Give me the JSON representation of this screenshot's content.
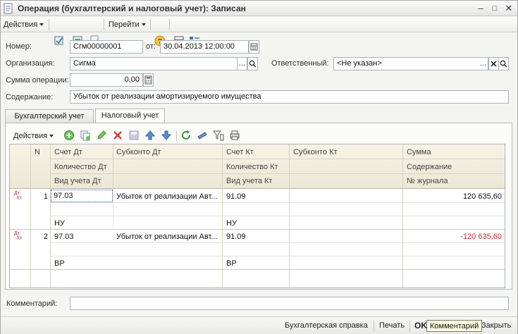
{
  "window": {
    "title": "Операция (бухгалтерский и налоговый учет): Записан",
    "controls": [
      "minimize-icon",
      "maximize-icon",
      "close-icon"
    ]
  },
  "toolbar": {
    "actions_label": "Действия",
    "goto_label": "Перейти"
  },
  "form": {
    "number_label": "Номер:",
    "number_value": "Сгм00000001",
    "date_label": "от:",
    "date_value": "30.04.2013 12:00:00",
    "org_label": "Организация:",
    "org_value": "Сигма",
    "org_btn": "...",
    "resp_label": "Ответственный:",
    "resp_value": "<Не указан>",
    "resp_btn": "...",
    "amount_label": "Сумма операции:",
    "amount_value": "0,00",
    "content_label": "Содержание:",
    "content_value": "Убыток от реализации амортизируемого имущества"
  },
  "tabs": [
    {
      "label": "Бухгалтерский учет",
      "active": false
    },
    {
      "label": "Налоговый учет",
      "active": true
    }
  ],
  "grid_toolbar": {
    "actions_label": "Действия"
  },
  "grid": {
    "headers": {
      "n": "N",
      "debit_account": "Счет Дт",
      "debit_subconto": "Субконто Дт",
      "credit_account": "Счет Кт",
      "credit_subconto": "Субконто Кт",
      "amount": "Сумма",
      "debit_qty": "Количество Дт",
      "credit_qty": "Количество Кт",
      "content": "Содержание",
      "debit_type": "Вид учета Дт",
      "credit_type": "Вид учета Кт",
      "journal_no": "№ журнала"
    },
    "rows": [
      {
        "n": "1",
        "debit_account": "97.03",
        "debit_subconto": "Убыток от реализации Авт...",
        "credit_account": "91.09",
        "amount": "120 635,60",
        "debit_type": "НУ",
        "credit_type": "НУ",
        "icon": "dt-kt-icon"
      },
      {
        "n": "2",
        "debit_account": "97.03",
        "debit_subconto": "Убыток от реализации Авт...",
        "credit_account": "91.09",
        "amount": "-120 635,60",
        "debit_type": "ВР",
        "credit_type": "ВР",
        "icon": "dt-kt-icon"
      }
    ]
  },
  "comment": {
    "label": "Комментарий:",
    "value": ""
  },
  "footer": {
    "report_label": "Бухгалтерская справка",
    "print_label": "Печать",
    "ok_label": "OK",
    "close_label": "Закрыть"
  },
  "tooltip": {
    "text": "Комментарий"
  },
  "colors": {
    "negative": "#d0252b",
    "accent": "#355fa5"
  }
}
